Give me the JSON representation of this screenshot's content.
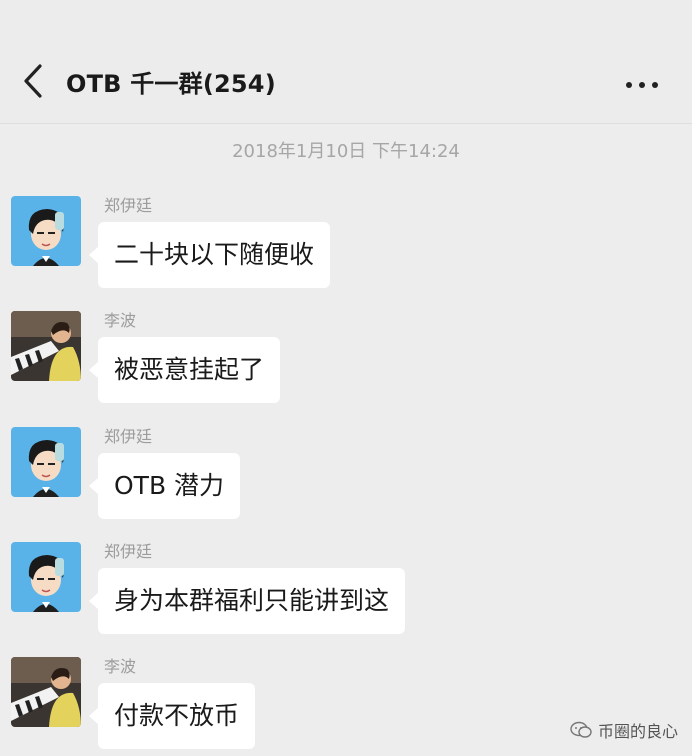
{
  "header": {
    "title": "OTB 千一群(254)",
    "back_icon": "chevron-left-icon",
    "more_icon": "more-dots-icon"
  },
  "timestamp": "2018年1月10日 下午14:24",
  "messages": [
    {
      "sender": "郑伊廷",
      "text": "二十块以下随便收",
      "avatar": "cartoon-boy-avatar"
    },
    {
      "sender": "李波",
      "text": "被恶意挂起了",
      "avatar": "piano-child-photo-avatar"
    },
    {
      "sender": "郑伊廷",
      "text": "OTB 潜力",
      "avatar": "cartoon-boy-avatar"
    },
    {
      "sender": "郑伊廷",
      "text": "身为本群福利只能讲到这",
      "avatar": "cartoon-boy-avatar"
    },
    {
      "sender": "李波",
      "text": "付款不放币",
      "avatar": "piano-child-photo-avatar"
    }
  ],
  "watermark": {
    "text": "币圈的良心",
    "icon": "wechat-logo-icon"
  },
  "colors": {
    "background": "#ededed",
    "bubble": "#ffffff",
    "timestamp": "#a6a6a6",
    "sender": "#9c9c9c"
  }
}
